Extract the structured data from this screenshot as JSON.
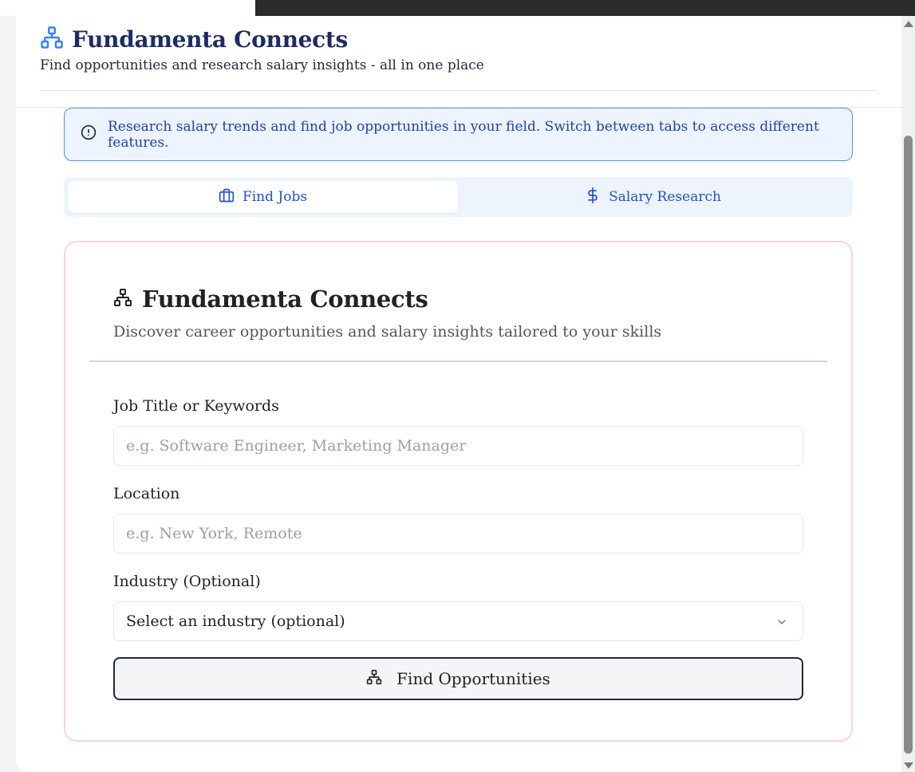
{
  "header": {
    "title": "Fundamenta Connects",
    "subtitle": "Find opportunities and research salary insights - all in one place",
    "icon": "network-icon"
  },
  "alert": {
    "icon": "info-circle-icon",
    "text": "Research salary trends and find job opportunities in your field. Switch between tabs to access different features."
  },
  "tabs": [
    {
      "label": "Find Jobs",
      "icon": "briefcase-icon",
      "active": true
    },
    {
      "label": "Salary Research",
      "icon": "dollar-icon",
      "active": false
    }
  ],
  "card": {
    "title": "Fundamenta Connects",
    "subtitle": "Discover career opportunities and salary insights tailored to your skills",
    "job_title_label": "Job Title or Keywords",
    "job_title_placeholder": "e.g. Software Engineer, Marketing Manager",
    "job_title_value": "",
    "location_label": "Location",
    "location_placeholder": "e.g. New York, Remote",
    "location_value": "",
    "industry_label": "Industry (Optional)",
    "industry_selected": "Select an industry (optional)",
    "submit_label": "Find Opportunities"
  },
  "colors": {
    "brand": "#1e2b63",
    "accent": "#1d4ed8",
    "icon_blue": "#3b82f6",
    "alert_bg": "#eef4ff",
    "alert_border": "#5b8def",
    "card_border": "#fbd5d5"
  }
}
